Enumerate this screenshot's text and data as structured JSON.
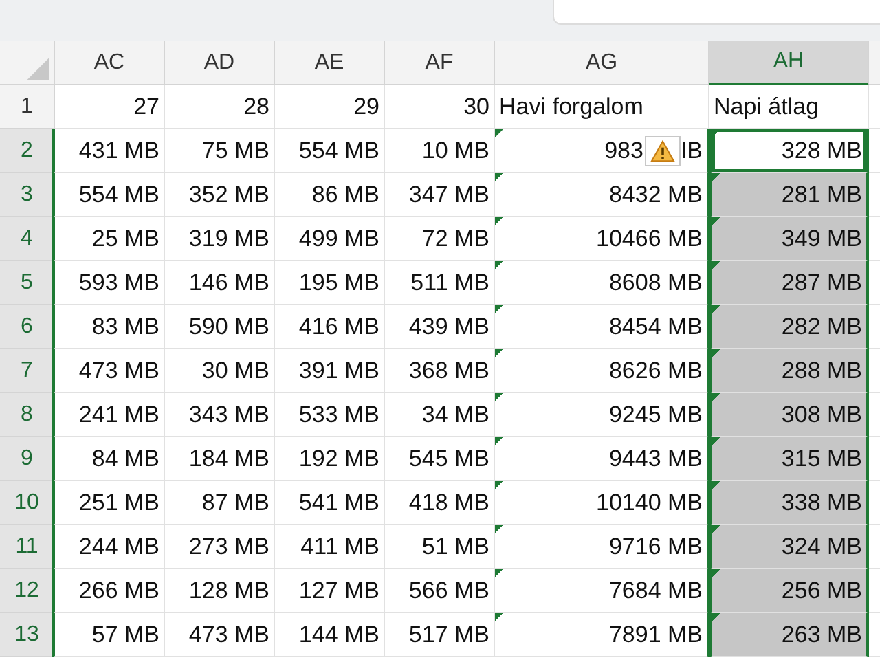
{
  "columns": [
    {
      "label": "AC",
      "selected": false
    },
    {
      "label": "AD",
      "selected": false
    },
    {
      "label": "AE",
      "selected": false
    },
    {
      "label": "AF",
      "selected": false
    },
    {
      "label": "AG",
      "selected": false
    },
    {
      "label": "AH",
      "selected": true
    }
  ],
  "rows": [
    {
      "number": "1",
      "selected": false,
      "days": [
        "27",
        "28",
        "29",
        "30"
      ],
      "total": {
        "text": "Havi forgalom",
        "flagged": false
      },
      "average": {
        "text": "Napi átlag",
        "flagged": false,
        "selected": false,
        "active": false
      }
    },
    {
      "number": "2",
      "selected": true,
      "days": [
        "431 MB",
        "75 MB",
        "554 MB",
        "10 MB"
      ],
      "total": {
        "text": "983",
        "tail": "IB",
        "warning": true,
        "flagged": true
      },
      "average": {
        "text": "328 MB",
        "flagged": true,
        "selected": true,
        "active": true
      }
    },
    {
      "number": "3",
      "selected": true,
      "days": [
        "554 MB",
        "352 MB",
        "86 MB",
        "347 MB"
      ],
      "total": {
        "text": "8432 MB",
        "flagged": true
      },
      "average": {
        "text": "281 MB",
        "flagged": true,
        "selected": true,
        "active": false
      }
    },
    {
      "number": "4",
      "selected": true,
      "days": [
        "25 MB",
        "319 MB",
        "499 MB",
        "72 MB"
      ],
      "total": {
        "text": "10466 MB",
        "flagged": true
      },
      "average": {
        "text": "349 MB",
        "flagged": true,
        "selected": true,
        "active": false
      }
    },
    {
      "number": "5",
      "selected": true,
      "days": [
        "593 MB",
        "146 MB",
        "195 MB",
        "511 MB"
      ],
      "total": {
        "text": "8608 MB",
        "flagged": true
      },
      "average": {
        "text": "287 MB",
        "flagged": true,
        "selected": true,
        "active": false
      }
    },
    {
      "number": "6",
      "selected": true,
      "days": [
        "83 MB",
        "590 MB",
        "416 MB",
        "439 MB"
      ],
      "total": {
        "text": "8454 MB",
        "flagged": true
      },
      "average": {
        "text": "282 MB",
        "flagged": true,
        "selected": true,
        "active": false
      }
    },
    {
      "number": "7",
      "selected": true,
      "days": [
        "473 MB",
        "30 MB",
        "391 MB",
        "368 MB"
      ],
      "total": {
        "text": "8626 MB",
        "flagged": true
      },
      "average": {
        "text": "288 MB",
        "flagged": true,
        "selected": true,
        "active": false
      }
    },
    {
      "number": "8",
      "selected": true,
      "days": [
        "241 MB",
        "343 MB",
        "533 MB",
        "34 MB"
      ],
      "total": {
        "text": "9245 MB",
        "flagged": true
      },
      "average": {
        "text": "308 MB",
        "flagged": true,
        "selected": true,
        "active": false
      }
    },
    {
      "number": "9",
      "selected": true,
      "days": [
        "84 MB",
        "184 MB",
        "192 MB",
        "545 MB"
      ],
      "total": {
        "text": "9443 MB",
        "flagged": true
      },
      "average": {
        "text": "315 MB",
        "flagged": true,
        "selected": true,
        "active": false
      }
    },
    {
      "number": "10",
      "selected": true,
      "days": [
        "251 MB",
        "87 MB",
        "541 MB",
        "418 MB"
      ],
      "total": {
        "text": "10140 MB",
        "flagged": true
      },
      "average": {
        "text": "338 MB",
        "flagged": true,
        "selected": true,
        "active": false
      }
    },
    {
      "number": "11",
      "selected": true,
      "days": [
        "244 MB",
        "273 MB",
        "411 MB",
        "51 MB"
      ],
      "total": {
        "text": "9716 MB",
        "flagged": true
      },
      "average": {
        "text": "324 MB",
        "flagged": true,
        "selected": true,
        "active": false
      }
    },
    {
      "number": "12",
      "selected": true,
      "days": [
        "266 MB",
        "128 MB",
        "127 MB",
        "566 MB"
      ],
      "total": {
        "text": "7684 MB",
        "flagged": true
      },
      "average": {
        "text": "256 MB",
        "flagged": true,
        "selected": true,
        "active": false
      }
    },
    {
      "number": "13",
      "selected": true,
      "days": [
        "57 MB",
        "473 MB",
        "144 MB",
        "517 MB"
      ],
      "total": {
        "text": "7891 MB",
        "flagged": true
      },
      "average": {
        "text": "263 MB",
        "flagged": true,
        "selected": true,
        "active": false
      }
    }
  ]
}
